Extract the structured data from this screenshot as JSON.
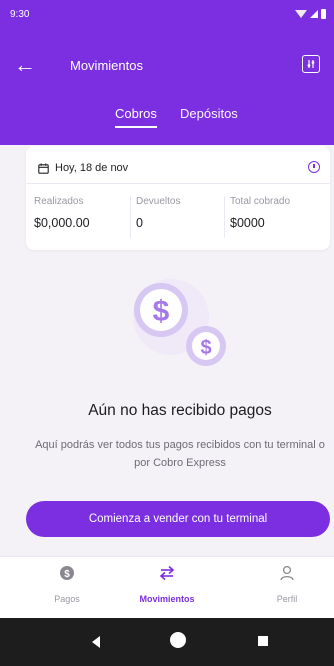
{
  "status_bar": {
    "time": "9:30"
  },
  "header": {
    "title": "Movimientos",
    "back_icon": "arrow-left-icon",
    "filter_icon": "filter-sliders-icon"
  },
  "tabs": [
    {
      "label": "Cobros",
      "active": true
    },
    {
      "label": "Depósitos",
      "active": false
    }
  ],
  "summary": {
    "date_icon": "calendar-icon",
    "date": "Hoy, 18 de nov",
    "info_icon": "info-icon",
    "stats": [
      {
        "label": "Realizados",
        "value": "$0,000.00"
      },
      {
        "label": "Devueltos",
        "value": "0"
      },
      {
        "label": "Total cobrado",
        "value": "$0000"
      }
    ]
  },
  "empty_state": {
    "illustration": "coins-dollar-icon",
    "title": "Aún no has recibido pagos",
    "description": "Aquí podrás ver todos tus pagos recibidos con tu terminal o por Cobro Express"
  },
  "cta": {
    "label": "Comienza a vender con tu terminal"
  },
  "bottom_nav": [
    {
      "label": "Pagos",
      "icon": "dollar-circle-icon",
      "active": false
    },
    {
      "label": "Movimientos",
      "icon": "transfer-arrows-icon",
      "active": true
    },
    {
      "label": "Perfil",
      "icon": "user-icon",
      "active": false
    }
  ],
  "colors": {
    "primary": "#7b2fe0",
    "background": "#f4f2f6",
    "muted_text": "#9a97a2"
  }
}
